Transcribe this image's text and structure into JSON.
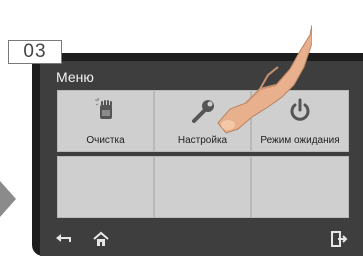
{
  "step_number": "03",
  "screen": {
    "title": "Меню",
    "tiles": [
      {
        "label": "Очистка",
        "icon": "cleaning-icon"
      },
      {
        "label": "Настройка",
        "icon": "wrench-icon"
      },
      {
        "label": "Режим ожидания",
        "icon": "power-icon"
      },
      {
        "label": "",
        "icon": ""
      },
      {
        "label": "",
        "icon": ""
      },
      {
        "label": "",
        "icon": ""
      }
    ],
    "bottom_bar": {
      "back_icon": "back-arrow-icon",
      "home_icon": "home-icon",
      "exit_icon": "exit-icon"
    }
  },
  "colors": {
    "screen_bg": "#3e3e3e",
    "frame": "#1d1d1d",
    "tile": "#cfcfcf",
    "text_light": "#f2f2f2"
  }
}
